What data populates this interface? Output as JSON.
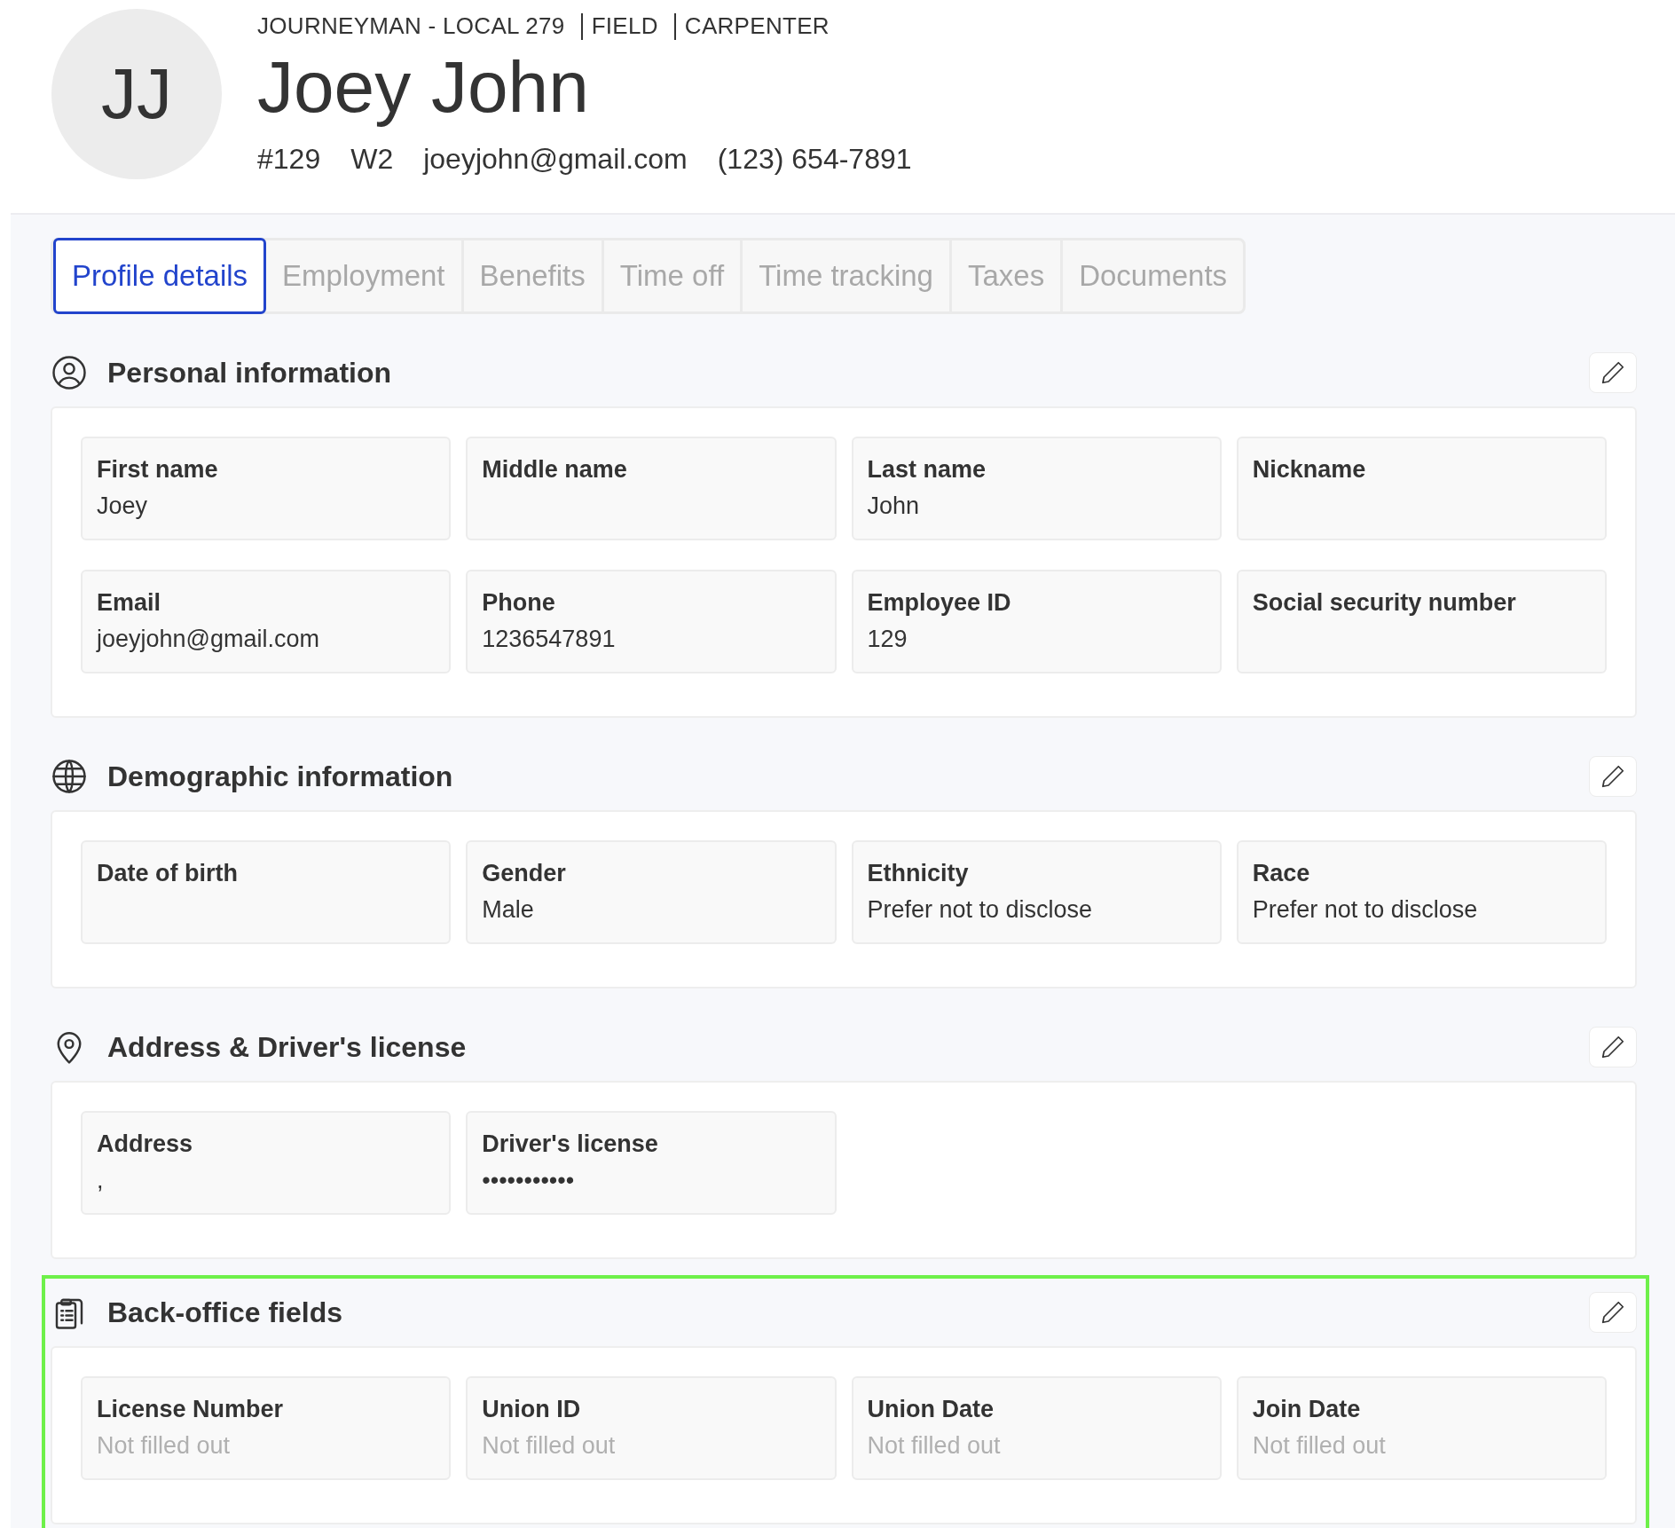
{
  "profile": {
    "initials": "JJ",
    "tags": [
      "JOURNEYMAN - LOCAL 279",
      "FIELD",
      "CARPENTER"
    ],
    "name": "Joey John",
    "meta": [
      "#129",
      "W2",
      "joeyjohn@gmail.com",
      "(123) 654-7891"
    ]
  },
  "tabs": [
    {
      "label": "Profile details",
      "selected": true
    },
    {
      "label": "Employment",
      "selected": false
    },
    {
      "label": "Benefits",
      "selected": false
    },
    {
      "label": "Time off",
      "selected": false
    },
    {
      "label": "Time tracking",
      "selected": false
    },
    {
      "label": "Taxes",
      "selected": false
    },
    {
      "label": "Documents",
      "selected": false
    }
  ],
  "sections": [
    {
      "title": "Personal information",
      "fields": [
        {
          "label": "First name",
          "value": "Joey",
          "filled": true
        },
        {
          "label": "Middle name"
        },
        {
          "label": "Last name",
          "value": "John",
          "filled": true
        },
        {
          "label": "Nickname"
        },
        {
          "label": "Email",
          "value": "joeyjohn@gmail.com",
          "filled": true
        },
        {
          "label": "Phone",
          "value": "1236547891",
          "filled": true
        },
        {
          "label": "Employee ID",
          "value": "129",
          "filled": true
        },
        {
          "label": "Social security number"
        }
      ]
    },
    {
      "title": "Demographic information",
      "fields": [
        {
          "label": "Date of birth"
        },
        {
          "label": "Gender",
          "value": "Male",
          "filled": true
        },
        {
          "label": "Ethnicity",
          "value": "Prefer not to disclose",
          "filled": true
        },
        {
          "label": "Race",
          "value": "Prefer not to disclose",
          "filled": true
        }
      ]
    },
    {
      "title": "Address & Driver's license",
      "fields": [
        {
          "label": "Address",
          "value": ",",
          "filled": true
        },
        {
          "label": "Driver's license",
          "value": "•••••••••••",
          "filled": true
        }
      ]
    },
    {
      "title": "Back-office fields",
      "highlighted": true,
      "fields": [
        {
          "label": "License Number",
          "value": "Not filled out",
          "filled": false
        },
        {
          "label": "Union ID",
          "value": "Not filled out",
          "filled": false
        },
        {
          "label": "Union Date",
          "value": "Not filled out",
          "filled": false
        },
        {
          "label": "Join Date",
          "value": "Not filled out",
          "filled": false
        }
      ]
    }
  ]
}
